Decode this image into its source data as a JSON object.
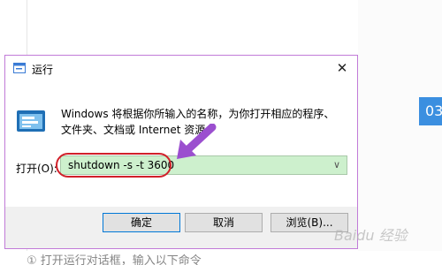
{
  "background": {
    "side_badge_text": "03",
    "bottom_text": "① 打开运行对话框，输入以下命令"
  },
  "dialog": {
    "title": "运行",
    "close_glyph": "✕",
    "description": "Windows 将根据你所输入的名称，为你打开相应的程序、文件夹、文档或 Internet 资源。",
    "open_label": "打开(O):",
    "command_value": "shutdown -s -t 3600",
    "dropdown_glyph": "∨",
    "buttons": {
      "ok": "确定",
      "cancel": "取消",
      "browse": "浏览(B)..."
    }
  },
  "annotations": {
    "highlight_color": "#d1202a",
    "arrow_color": "#9b4fcf"
  },
  "watermark": "Baidu 经验",
  "icons": [
    "run-app-icon",
    "run-program-icon",
    "close-icon",
    "chevron-down-icon",
    "arrow-annotation-icon"
  ]
}
